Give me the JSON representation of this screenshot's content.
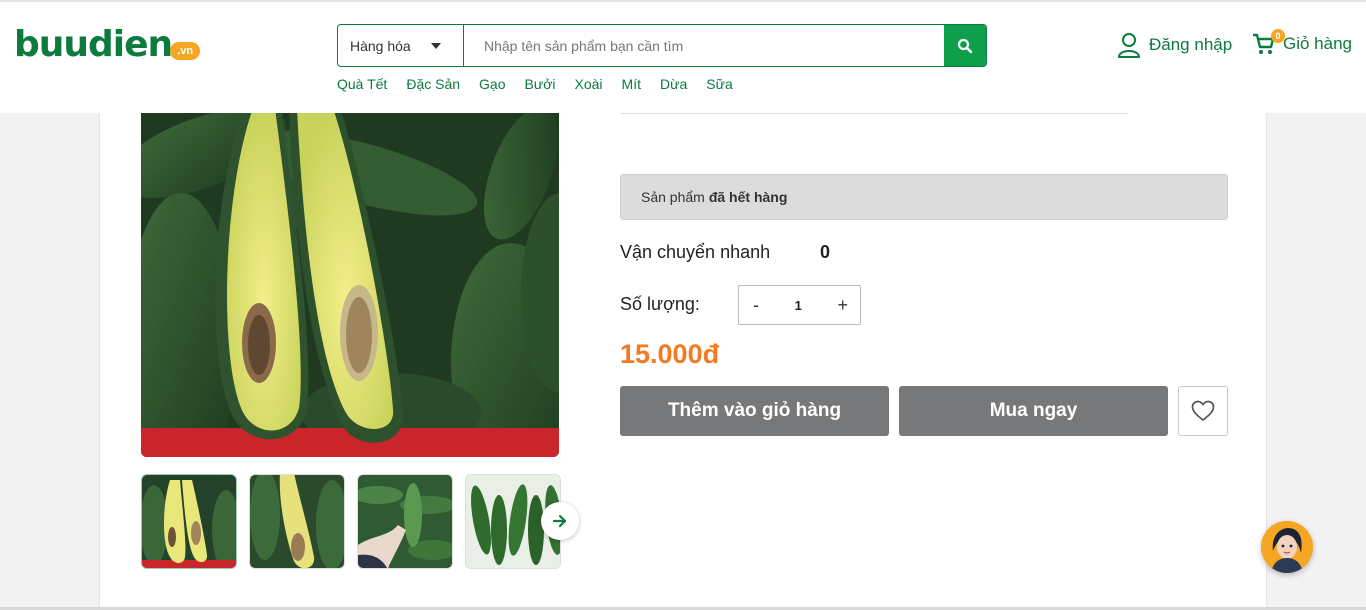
{
  "header": {
    "logo": {
      "text": "buudien",
      "badge": ".vn"
    },
    "search": {
      "category_selected": "Hàng hóa",
      "placeholder": "Nhập tên sản phẩm bạn cần tìm",
      "value": ""
    },
    "quick_links": [
      "Quà Tết",
      "Đặc Sản",
      "Gạo",
      "Bưởi",
      "Xoài",
      "Mít",
      "Dừa",
      "Sữa"
    ],
    "login_label": "Đăng nhập",
    "cart_label": "Giỏ hàng",
    "cart_count": "0"
  },
  "product": {
    "stock_prefix": "Sản phẩm",
    "stock_status": "đã hết hàng",
    "shipping_label": "Vận chuyển nhanh",
    "shipping_value": "0",
    "quantity_label": "Số lượng:",
    "quantity_minus": "-",
    "quantity_value": "1",
    "quantity_plus": "+",
    "price": "15.000đ",
    "add_to_cart_label": "Thêm vào giỏ hàng",
    "buy_now_label": "Mua ngay"
  },
  "gallery": {
    "main_image": "avocado-halves-image",
    "thumbnails": [
      "avocado-halves-thumb",
      "avocado-cut-thumb",
      "avocado-hand-thumb",
      "avocado-basket-thumb"
    ]
  },
  "icons": {
    "search": "search-icon",
    "user": "user-icon",
    "cart": "cart-icon",
    "heart": "heart-icon",
    "arrow": "arrow-right-icon",
    "chat": "chat-avatar-icon"
  },
  "colors": {
    "brand_green": "#0d7a3e",
    "search_button": "#0d9f4b",
    "price_orange": "#f47a20",
    "button_gray": "#777879",
    "badge_orange": "#f5a623"
  }
}
